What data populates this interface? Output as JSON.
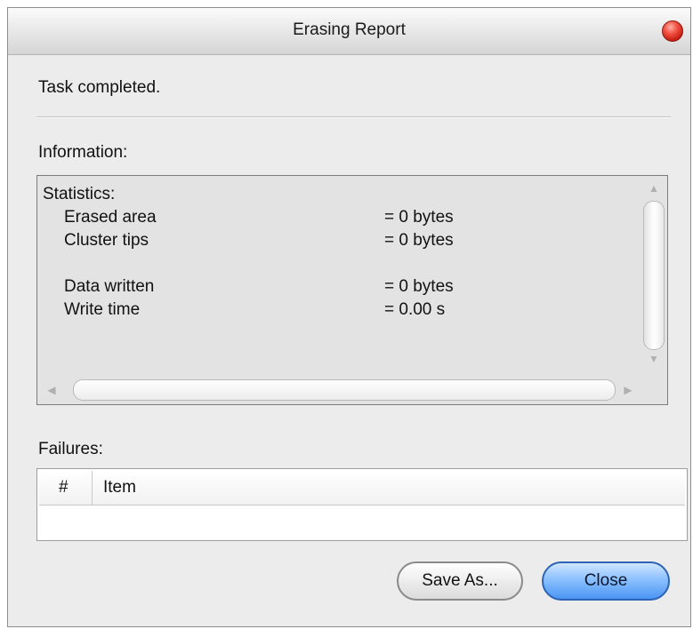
{
  "window": {
    "title": "Erasing Report"
  },
  "status": {
    "text": "Task completed."
  },
  "information": {
    "label": "Information:",
    "heading": "Statistics:",
    "rows": [
      {
        "label": "Erased area",
        "value": "= 0 bytes"
      },
      {
        "label": "Cluster tips",
        "value": "= 0 bytes"
      },
      {
        "label": "Data written",
        "value": "= 0 bytes"
      },
      {
        "label": "Write time",
        "value": "= 0.00 s"
      }
    ]
  },
  "failures": {
    "label": "Failures:",
    "columns": [
      "#",
      "Item"
    ]
  },
  "buttons": {
    "save_as": "Save As...",
    "close": "Close"
  },
  "icons": {
    "close_window": "close-icon",
    "scroll_up": "chevron-up-icon",
    "scroll_down": "chevron-down-icon",
    "scroll_left": "chevron-left-icon",
    "scroll_right": "chevron-right-icon"
  },
  "colors": {
    "close_button": "#4a95f3",
    "close_dot": "#e53a2b"
  }
}
